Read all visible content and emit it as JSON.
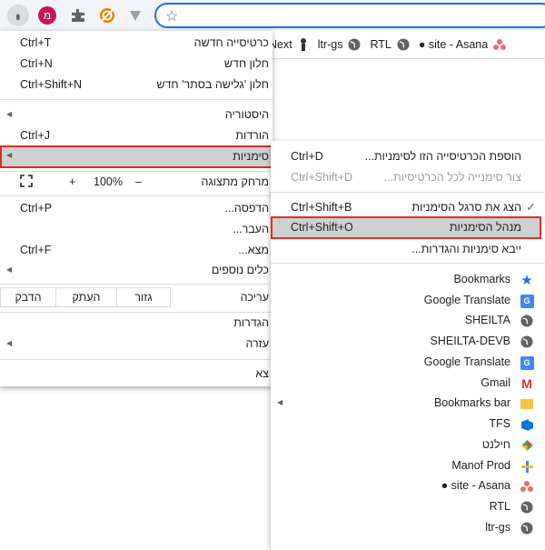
{
  "toolbar": {
    "avatar_letter": "מ",
    "icons": [
      "kebab-menu-icon",
      "avatar",
      "puzzle-extensions-icon",
      "vpn-extension-icon",
      "vuetify-extension-icon",
      "bookmark-star-icon"
    ]
  },
  "bookmarks_bar": {
    "items": [
      {
        "label": "Next",
        "icon": "next-icon"
      },
      {
        "label": "ltr-gs",
        "icon": "globe-icon"
      },
      {
        "label": "RTL",
        "icon": "globe-icon"
      },
      {
        "label": "● site - Asana",
        "icon": "asana-icon"
      }
    ]
  },
  "menu": {
    "new_tab": {
      "label": "כרטיסייה חדשה",
      "shortcut": "Ctrl+T"
    },
    "new_window": {
      "label": "חלון חדש",
      "shortcut": "Ctrl+N"
    },
    "incognito": {
      "label": "חלון 'גלישה בסתר' חדש",
      "shortcut": "Ctrl+Shift+N"
    },
    "history": {
      "label": "היסטוריה"
    },
    "downloads": {
      "label": "הורדות",
      "shortcut": "Ctrl+J"
    },
    "bookmarks": {
      "label": "סימניות"
    },
    "zoom": {
      "label": "מרחק מתצוגה",
      "minus": "–",
      "value": "100%",
      "plus": "+"
    },
    "print": {
      "label": "הדפסה...",
      "shortcut": "Ctrl+P"
    },
    "cast": {
      "label": "העבר..."
    },
    "find": {
      "label": "מצא...",
      "shortcut": "Ctrl+F"
    },
    "more_tools": {
      "label": "כלים נוספים"
    },
    "edit": {
      "label": "עריכה",
      "cut": "גזור",
      "copy": "העתק",
      "paste": "הדבק"
    },
    "settings": {
      "label": "הגדרות"
    },
    "help": {
      "label": "עזרה"
    },
    "exit": {
      "label": "צא"
    }
  },
  "submenu": {
    "bookmark_tab": {
      "label": "הוספת הכרטיסייה הזו לסימניות...",
      "shortcut": "Ctrl+D"
    },
    "bookmark_all": {
      "label": "צור סימנייה לכל הכרטיסיות...",
      "shortcut": "Ctrl+Shift+D"
    },
    "show_bar": {
      "label": "הצג את סרגל הסימניות",
      "shortcut": "Ctrl+Shift+B"
    },
    "manager": {
      "label": "מנהל הסימניות",
      "shortcut": "Ctrl+Shift+O"
    },
    "import": {
      "label": "ייבא סימניות והגדרות..."
    },
    "items": [
      {
        "label": "Bookmarks",
        "icon": "star-icon"
      },
      {
        "label": "Google Translate",
        "icon": "google-translate-icon"
      },
      {
        "label": "SHEILTA",
        "icon": "globe-icon"
      },
      {
        "label": "SHEILTA-DEVB",
        "icon": "globe-icon"
      },
      {
        "label": "Google Translate",
        "icon": "google-translate-icon"
      },
      {
        "label": "Gmail",
        "icon": "gmail-icon"
      },
      {
        "label": "Bookmarks bar",
        "icon": "folder-icon"
      },
      {
        "label": "TFS",
        "icon": "azure-devops-icon"
      },
      {
        "label": "חילנט",
        "icon": "hilanet-icon"
      },
      {
        "label": "Manof Prod",
        "icon": "manof-icon"
      },
      {
        "label": "● site - Asana",
        "icon": "asana-icon"
      },
      {
        "label": "RTL",
        "icon": "globe-icon"
      },
      {
        "label": "ltr-gs",
        "icon": "globe-icon"
      }
    ]
  },
  "colors": {
    "highlight_border": "#d93025",
    "highlight_bg": "#cfd0d2",
    "accent": "#1a73e8"
  }
}
